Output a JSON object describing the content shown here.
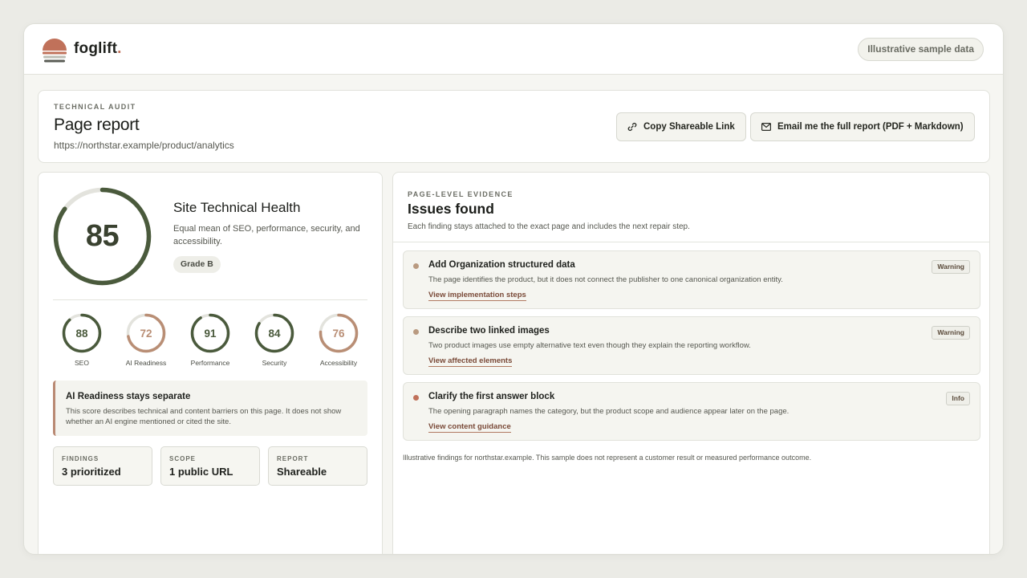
{
  "brand": {
    "name": "foglift",
    "dot": ".",
    "sample_label": "Illustrative sample data"
  },
  "report": {
    "eyebrow": "TECHNICAL AUDIT",
    "title": "Page report",
    "url": "https://northstar.example/product/analytics",
    "copy_label": "Copy Shareable Link",
    "email_label": "Email me the full report (PDF + Markdown)"
  },
  "health": {
    "score": 85,
    "score_text": "85",
    "title": "Site Technical Health",
    "description": "Equal mean of SEO, performance, security, and accessibility.",
    "grade": "Grade B"
  },
  "metrics": [
    {
      "label": "SEO",
      "score": 88,
      "score_text": "88",
      "color": "#4a5a3c"
    },
    {
      "label": "AI Readiness",
      "score": 72,
      "score_text": "72",
      "color": "#b98e75"
    },
    {
      "label": "Performance",
      "score": 91,
      "score_text": "91",
      "color": "#4a5a3c"
    },
    {
      "label": "Security",
      "score": 84,
      "score_text": "84",
      "color": "#4a5a3c"
    },
    {
      "label": "Accessibility",
      "score": 76,
      "score_text": "76",
      "color": "#b98e75"
    }
  ],
  "ai_note": {
    "title": "AI Readiness stays separate",
    "text": "This score describes technical and content barriers on this page. It does not show whether an AI engine mentioned or cited the site."
  },
  "stats": [
    {
      "label": "FINDINGS",
      "value": "3 prioritized"
    },
    {
      "label": "SCOPE",
      "value": "1 public URL"
    },
    {
      "label": "REPORT",
      "value": "Shareable"
    }
  ],
  "issues_panel": {
    "eyebrow": "PAGE-LEVEL EVIDENCE",
    "title": "Issues found",
    "subtitle": "Each finding stays attached to the exact page and includes the next repair step."
  },
  "issues": [
    {
      "title": "Add Organization structured data",
      "text": "The page identifies the product, but it does not connect the publisher to one canonical organization entity.",
      "link": "View implementation steps",
      "badge": "Warning",
      "dot_color": "#b99a80"
    },
    {
      "title": "Describe two linked images",
      "text": "Two product images use empty alternative text even though they explain the reporting workflow.",
      "link": "View affected elements",
      "badge": "Warning",
      "dot_color": "#b99a80"
    },
    {
      "title": "Clarify the first answer block",
      "text": "The opening paragraph names the category, but the product scope and audience appear later on the page.",
      "link": "View content guidance",
      "badge": "Info",
      "dot_color": "#c0715a"
    }
  ],
  "footnote": "Illustrative findings for northstar.example. This sample does not represent a customer result or measured performance outcome.",
  "colors": {
    "ring_dark": "#4a5a3c",
    "ring_track": "#e3e3dd",
    "accent_clay": "#c0715a"
  }
}
